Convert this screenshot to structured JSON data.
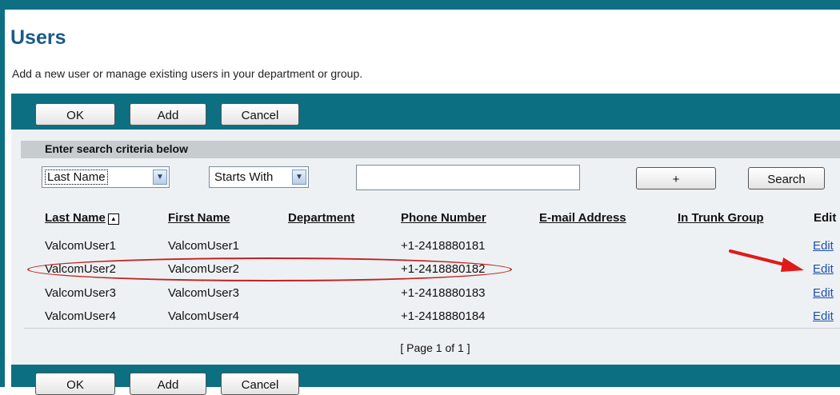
{
  "page": {
    "title": "Users",
    "subtitle": "Add a new user or manage existing users in your department or group."
  },
  "actions": {
    "ok": "OK",
    "add": "Add",
    "cancel": "Cancel"
  },
  "search": {
    "heading": "Enter search criteria below",
    "field_selected": "Last Name",
    "operator_selected": "Starts With",
    "value": "",
    "add_criteria_label": "+",
    "search_label": "Search"
  },
  "table": {
    "columns": [
      "Last Name",
      "First Name",
      "Department",
      "Phone Number",
      "E-mail Address",
      "In Trunk Group",
      "Edit"
    ],
    "sort_indicator": "▲",
    "rows": [
      {
        "last": "ValcomUser1",
        "first": "ValcomUser1",
        "department": "",
        "phone": "+1-2418880181",
        "email": "",
        "trunk": "",
        "edit": "Edit"
      },
      {
        "last": "ValcomUser2",
        "first": "ValcomUser2",
        "department": "",
        "phone": "+1-2418880182",
        "email": "",
        "trunk": "",
        "edit": "Edit"
      },
      {
        "last": "ValcomUser3",
        "first": "ValcomUser3",
        "department": "",
        "phone": "+1-2418880183",
        "email": "",
        "trunk": "",
        "edit": "Edit"
      },
      {
        "last": "ValcomUser4",
        "first": "ValcomUser4",
        "department": "",
        "phone": "+1-2418880184",
        "email": "",
        "trunk": "",
        "edit": "Edit"
      }
    ]
  },
  "pager": {
    "text": "[ Page 1 of 1 ]"
  },
  "annotations": {
    "highlight_color": "#c42020",
    "arrow_color": "#e01a1a"
  },
  "colors": {
    "brand_teal": "#0c6f82",
    "title_blue": "#1a5a8a",
    "link_blue": "#1a4fb5"
  }
}
